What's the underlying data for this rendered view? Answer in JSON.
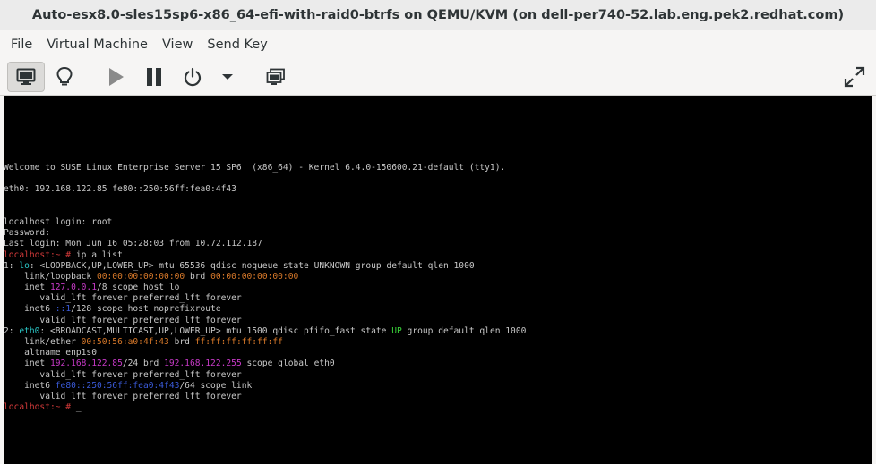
{
  "window": {
    "title": "Auto-esx8.0-sles15sp6-x86_64-efi-with-raid0-btrfs on QEMU/KVM (on dell-per740-52.lab.eng.pek2.redhat.com)"
  },
  "menubar": {
    "items": [
      "File",
      "Virtual Machine",
      "View",
      "Send Key"
    ]
  },
  "toolbar": {
    "icons": [
      "console-icon",
      "lightbulb-icon",
      "play-icon",
      "pause-icon",
      "power-icon",
      "dropdown-arrow-icon",
      "snapshots-icon",
      "fullscreen-icon"
    ]
  },
  "colors": {
    "prompt": "#d43a3a",
    "interface": "#2ac4c4",
    "mac": "#d8792a",
    "ip": "#c83ac8",
    "state_up": "#3ad43a",
    "ipv6": "#3a5ad8"
  },
  "terminal": {
    "lines": [
      [
        {
          "t": "Welcome to SUSE Linux Enterprise Server 15 SP6  (x86_64) - Kernel 6.4.0-150600.21-default (tty1)."
        }
      ],
      [
        {
          "t": ""
        }
      ],
      [
        {
          "t": "eth0: 192.168.122.85 fe80::250:56ff:fea0:4f43"
        }
      ],
      [
        {
          "t": ""
        }
      ],
      [
        {
          "t": ""
        }
      ],
      [
        {
          "t": "localhost login: root"
        }
      ],
      [
        {
          "t": "Password:"
        }
      ],
      [
        {
          "t": "Last login: Mon Jun 16 05:28:03 from 10.72.112.187"
        }
      ],
      [
        {
          "t": "localhost:~ #",
          "c": "c-red"
        },
        {
          "t": " ip a list"
        }
      ],
      [
        {
          "t": "1: "
        },
        {
          "t": "lo",
          "c": "c-cyan"
        },
        {
          "t": ": <LOOPBACK,UP,LOWER_UP> mtu 65536 qdisc noqueue state UNKNOWN group default qlen 1000"
        }
      ],
      [
        {
          "t": "    link/loopback "
        },
        {
          "t": "00:00:00:00:00:00",
          "c": "c-orange"
        },
        {
          "t": " brd "
        },
        {
          "t": "00:00:00:00:00:00",
          "c": "c-orange"
        }
      ],
      [
        {
          "t": "    inet "
        },
        {
          "t": "127.0.0.1",
          "c": "c-magenta"
        },
        {
          "t": "/8 scope host lo"
        }
      ],
      [
        {
          "t": "       valid_lft forever preferred_lft forever"
        }
      ],
      [
        {
          "t": "    inet6 "
        },
        {
          "t": "::1",
          "c": "c-blue"
        },
        {
          "t": "/128 scope host noprefixroute"
        }
      ],
      [
        {
          "t": "       valid_lft forever preferred_lft forever"
        }
      ],
      [
        {
          "t": "2: "
        },
        {
          "t": "eth0",
          "c": "c-cyan"
        },
        {
          "t": ": <BROADCAST,MULTICAST,UP,LOWER_UP> mtu 1500 qdisc pfifo_fast state "
        },
        {
          "t": "UP",
          "c": "c-green"
        },
        {
          "t": " group default qlen 1000"
        }
      ],
      [
        {
          "t": "    link/ether "
        },
        {
          "t": "00:50:56:a0:4f:43",
          "c": "c-orange"
        },
        {
          "t": " brd "
        },
        {
          "t": "ff:ff:ff:ff:ff:ff",
          "c": "c-orange"
        }
      ],
      [
        {
          "t": "    altname enp1s0"
        }
      ],
      [
        {
          "t": "    inet "
        },
        {
          "t": "192.168.122.85",
          "c": "c-magenta"
        },
        {
          "t": "/24 brd "
        },
        {
          "t": "192.168.122.255",
          "c": "c-magenta"
        },
        {
          "t": " scope global eth0"
        }
      ],
      [
        {
          "t": "       valid_lft forever preferred_lft forever"
        }
      ],
      [
        {
          "t": "    inet6 "
        },
        {
          "t": "fe80::250:56ff:fea0:4f43",
          "c": "c-blue"
        },
        {
          "t": "/64 scope link"
        }
      ],
      [
        {
          "t": "       valid_lft forever preferred_lft forever"
        }
      ],
      [
        {
          "t": "localhost:~ #",
          "c": "c-red"
        },
        {
          "t": " _"
        }
      ]
    ]
  }
}
